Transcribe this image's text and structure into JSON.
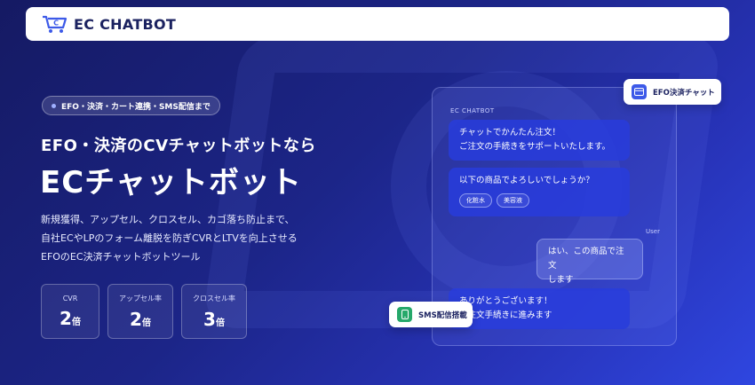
{
  "header": {
    "logo_text": "EC CHATBOT",
    "logo_icon": "cart-chat-icon"
  },
  "hero": {
    "pill": "EFO・決済・カート連携・SMS配信まで",
    "sub_heading": "EFO・決済のCVチャットボットなら",
    "main_heading": "ECチャットボット",
    "description": [
      "新規獲得、アップセル、クロスセル、カゴ落ち防止まで、",
      "自社ECやLPのフォーム離脱を防ぎCVRとLTVを向上させる",
      "EFOのEC決済チャットボットツール"
    ],
    "stats": [
      {
        "label": "CVR",
        "value": "2",
        "unit": "倍"
      },
      {
        "label": "アップセル率",
        "value": "2",
        "unit": "倍"
      },
      {
        "label": "クロスセル率",
        "value": "3",
        "unit": "倍"
      }
    ]
  },
  "chat": {
    "brand": "EC CHATBOT",
    "bot_message_1": [
      "チャットでかんたん注文！",
      "ご注文の手続きをサポートいたします。"
    ],
    "bot_message_2": "以下の商品でよろしいでしょうか？",
    "chips": [
      "化粧水",
      "美容液"
    ],
    "user_tag": "User",
    "user_message": [
      "はい、この商品で注文",
      "します"
    ],
    "bot_message_3": [
      "ありがとうございます！",
      "ご注文手続きに進みます"
    ]
  },
  "badges": {
    "efo": {
      "label": "EFO決済チャット",
      "icon": "card-icon"
    },
    "sms": {
      "label": "SMS配信搭載",
      "icon": "phone-icon"
    }
  },
  "colors": {
    "background_start": "#151a63",
    "background_end": "#2f46e0",
    "bot_bubble": "#2b3fe0",
    "efo_icon": "#3d5ae8",
    "sms_icon": "#26a86a"
  }
}
